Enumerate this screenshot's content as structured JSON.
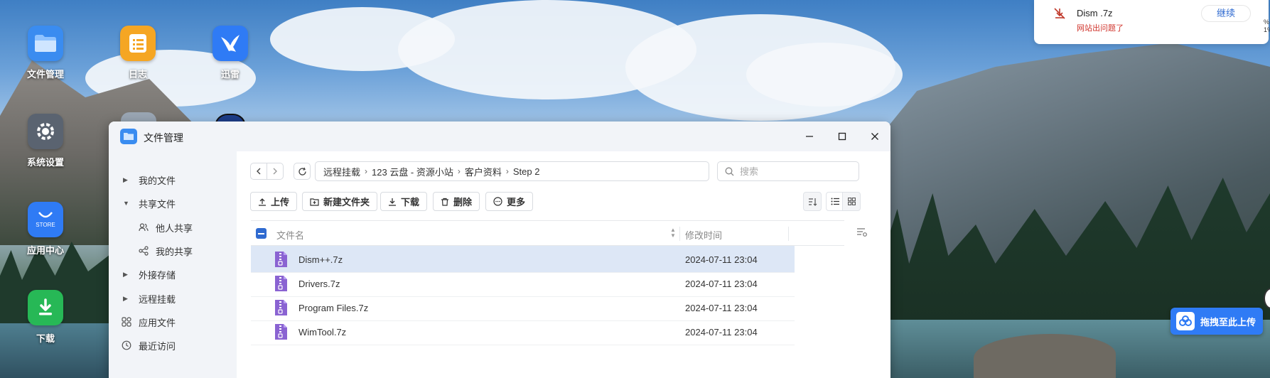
{
  "desktop": {
    "icons": [
      {
        "label": "文件管理",
        "icon": "folder-icon",
        "color": "#3a8cf0"
      },
      {
        "label": "日志",
        "icon": "log-icon",
        "color": "#f5a623"
      },
      {
        "label": "迅雷",
        "icon": "thunder-bird-icon",
        "color": "#2f7bf5"
      },
      {
        "label": "系统设置",
        "icon": "settings-icon",
        "color": "#5a6370"
      },
      {
        "label": "应用中心",
        "icon": "store-icon",
        "color": "#2f7bf5",
        "badge": "STORE"
      },
      {
        "label": "下载",
        "icon": "download-icon",
        "color": "#27b856"
      }
    ]
  },
  "notification": {
    "title": "Dism .7z",
    "message": "网站出问题了",
    "action": "继续",
    "edge_text": "%\n1%"
  },
  "drop_badge": {
    "label": "拖拽至此上传"
  },
  "window": {
    "title": "文件管理",
    "sidebar": [
      {
        "label": "我的文件",
        "kind": "expandable",
        "expanded": false
      },
      {
        "label": "共享文件",
        "kind": "expandable",
        "expanded": true
      },
      {
        "label": "他人共享",
        "kind": "sub",
        "icon": "users-icon"
      },
      {
        "label": "我的共享",
        "kind": "sub",
        "icon": "share-icon"
      },
      {
        "label": "外接存储",
        "kind": "expandable",
        "expanded": false
      },
      {
        "label": "远程挂载",
        "kind": "expandable",
        "expanded": false
      },
      {
        "label": "应用文件",
        "kind": "icon",
        "icon": "apps-icon"
      },
      {
        "label": "最近访问",
        "kind": "icon",
        "icon": "clock-icon"
      }
    ],
    "breadcrumb": [
      "远程挂载",
      "123 云盘 - 资源小站",
      "客户资料",
      "Step 2"
    ],
    "search_placeholder": "搜索",
    "toolbar": {
      "upload": "上传",
      "new_folder": "新建文件夹",
      "download": "下载",
      "delete": "删除",
      "more": "更多"
    },
    "table": {
      "col_name": "文件名",
      "col_modified": "修改时间",
      "rows": [
        {
          "name": "Dism++.7z",
          "modified": "2024-07-11 23:04",
          "selected": true
        },
        {
          "name": "Drivers.7z",
          "modified": "2024-07-11 23:04",
          "selected": false
        },
        {
          "name": "Program Files.7z",
          "modified": "2024-07-11 23:04",
          "selected": false
        },
        {
          "name": "WimTool.7z",
          "modified": "2024-07-11 23:04",
          "selected": false
        }
      ]
    }
  }
}
